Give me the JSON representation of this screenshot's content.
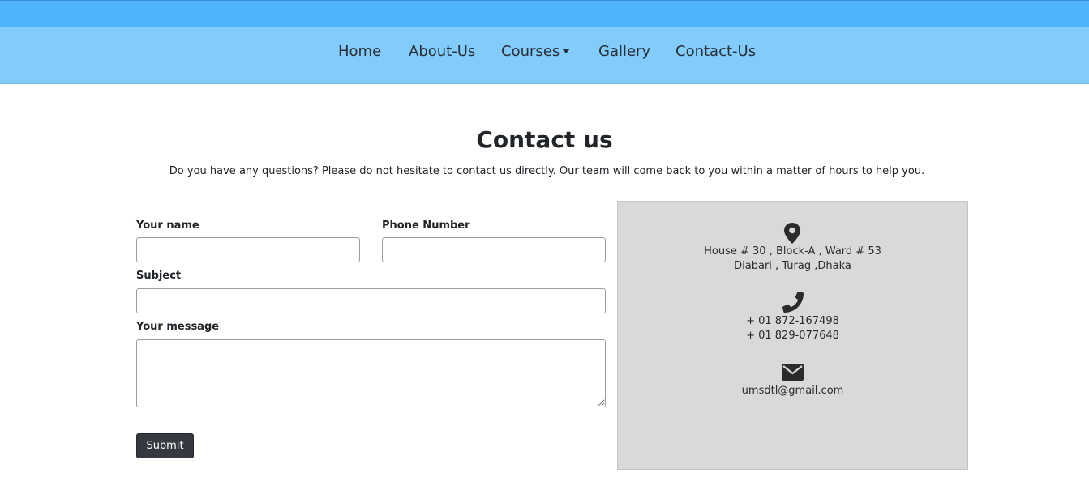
{
  "nav": {
    "home": "Home",
    "about": "About-Us",
    "courses": "Courses",
    "gallery": "Gallery",
    "contact": "Contact-Us"
  },
  "page": {
    "title": "Contact us",
    "subtitle": "Do you have any questions? Please do not hesitate to contact us directly. Our team will come back to you within a matter of hours to help you."
  },
  "form": {
    "name_label": "Your name",
    "phone_label": "Phone Number",
    "subject_label": "Subject",
    "message_label": "Your message",
    "name_value": "",
    "phone_value": "",
    "subject_value": "",
    "message_value": "",
    "submit_label": "Submit"
  },
  "contact_info": {
    "address_line1": "House # 30 , Block-A , Ward # 53",
    "address_line2": "Diabari , Turag ,Dhaka",
    "phone1": "+ 01 872-167498",
    "phone2": "+ 01 829-077648",
    "email": "umsdtl@gmail.com",
    "icons": [
      "map-marker-icon",
      "phone-icon",
      "envelope-icon"
    ]
  },
  "colors": {
    "top_strip": "#4db4fb",
    "navbar": "#82cbfd",
    "info_box": "#d9d9d9",
    "submit_bg": "#343a40"
  }
}
